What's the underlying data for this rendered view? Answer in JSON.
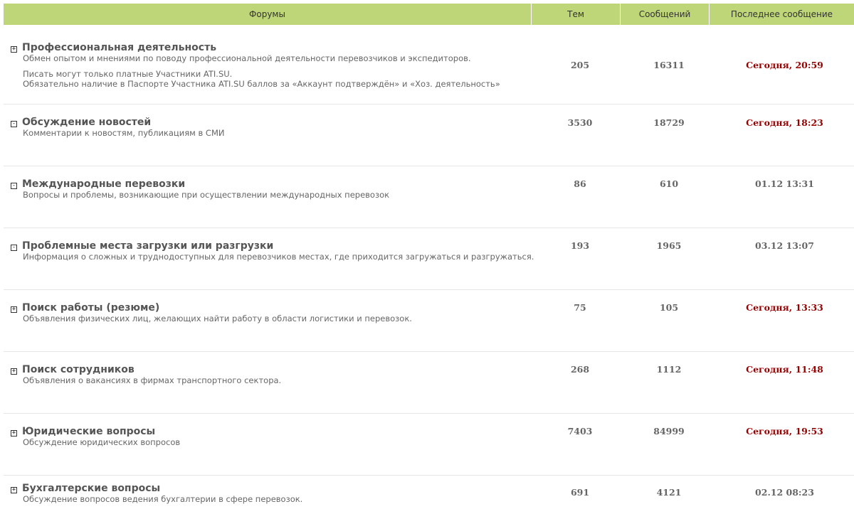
{
  "header": {
    "forums": "Форумы",
    "topics": "Тем",
    "messages": "Сообщений",
    "last": "Последнее сообщение"
  },
  "forums": [
    {
      "toggle": "+",
      "title": "Профессиональная деятельность",
      "desc": "Обмен опытом и мнениями по поводу профессиональной деятельности перевозчиков и экспедиторов.",
      "note1": "Писать могут только платные Участники ATI.SU.",
      "note2": "Обязательно наличие в Паспорте Участника ATI.SU баллов за «Аккаунт подтверждён» и «Хоз. деятельность»",
      "topics": "205",
      "messages": "16311",
      "last": "Сегодня, 20:59"
    },
    {
      "toggle": "-",
      "title": "Обсуждение новостей",
      "desc": "Комментарии к новостям, публикациям в СМИ",
      "topics": "3530",
      "messages": "18729",
      "last": "Сегодня, 18:23"
    },
    {
      "toggle": "-",
      "title": "Международные перевозки",
      "desc": "Вопросы и проблемы, возникающие при осуществлении международных перевозок",
      "topics": "86",
      "messages": "610",
      "last": "01.12 13:31"
    },
    {
      "toggle": "-",
      "title": "Проблемные места загрузки или разгрузки",
      "desc": "Информация о сложных и труднодоступных для перевозчиков местах, где приходится загружаться и разгружаться.",
      "topics": "193",
      "messages": "1965",
      "last": "03.12 13:07"
    },
    {
      "toggle": "+",
      "title": "Поиск работы (резюме)",
      "desc": "Объявления физических лиц, желающих найти работу в области логистики и перевозок.",
      "topics": "75",
      "messages": "105",
      "last": "Сегодня, 13:33"
    },
    {
      "toggle": "+",
      "title": "Поиск сотрудников",
      "desc": "Объявления о вакансиях в фирмах транспортного сектора.",
      "topics": "268",
      "messages": "1112",
      "last": "Сегодня, 11:48"
    },
    {
      "toggle": "+",
      "title": "Юридические вопросы",
      "desc": "Обсуждение юридических вопросов",
      "topics": "7403",
      "messages": "84999",
      "last": "Сегодня, 19:53"
    },
    {
      "toggle": "+",
      "title": "Бухгалтерские вопросы",
      "desc": "Обсуждение вопросов ведения бухгалтерии в сфере перевозок.",
      "topics": "691",
      "messages": "4121",
      "last": "02.12 08:23"
    }
  ],
  "colors": {
    "header_bg": "#bed677",
    "recent_last": "#990000"
  }
}
